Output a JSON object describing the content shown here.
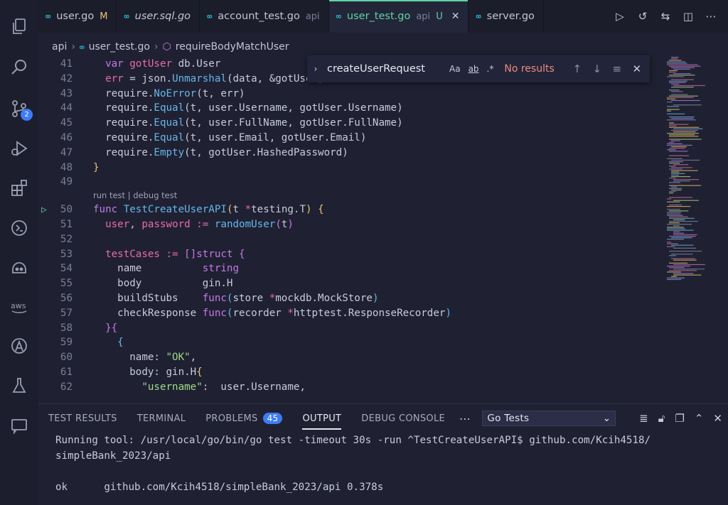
{
  "tabs": [
    {
      "name": "user.go",
      "icon": "go",
      "status": "M",
      "dir": "",
      "active": false,
      "italic": false
    },
    {
      "name": "user.sql.go",
      "icon": "go",
      "status": "",
      "dir": "",
      "active": false,
      "italic": true
    },
    {
      "name": "account_test.go",
      "icon": "go",
      "status": "",
      "dir": "api",
      "active": false,
      "italic": false
    },
    {
      "name": "user_test.go",
      "icon": "go",
      "status": "U",
      "dir": "api",
      "active": true,
      "italic": false
    },
    {
      "name": "server.go",
      "icon": "go",
      "status": "",
      "dir": "",
      "active": false,
      "italic": false
    }
  ],
  "tab_icon_glyph": "∞",
  "close_glyph": "✕",
  "breadcrumb": {
    "folder": "api",
    "file": "user_test.go",
    "symbol": "requireBodyMatchUser"
  },
  "find": {
    "query": "createUserRequest",
    "match_case": "Aa",
    "whole_word": "ab",
    "regex": ".*",
    "result": "No results"
  },
  "codelens": "run test | debug test",
  "code_lines": [
    {
      "n": "41",
      "html": "  <span class='kw'>var</span> <span class='id'>gotUser</span> db.User"
    },
    {
      "n": "42",
      "html": "  <span class='id'>err</span> = json.<span class='fn'>Unmarshal</span>(data, &amp;gotUser)"
    },
    {
      "n": "43",
      "html": "  require.<span class='fn'>NoError</span>(t, err)"
    },
    {
      "n": "44",
      "html": "  require.<span class='fn'>Equal</span>(t, user.Username, gotUser.Username)"
    },
    {
      "n": "45",
      "html": "  require.<span class='fn'>Equal</span>(t, user.FullName, gotUser.FullName)"
    },
    {
      "n": "46",
      "html": "  require.<span class='fn'>Equal</span>(t, user.Email, gotUser.Email)"
    },
    {
      "n": "47",
      "html": "  require.<span class='fn'>Empty</span>(t, gotUser.HashedPassword)"
    },
    {
      "n": "48",
      "html": "<span class='br1'>}</span>"
    },
    {
      "n": "49",
      "html": ""
    },
    {
      "n": "50",
      "html": "<span class='kw'>func</span> <span class='fn'>TestCreateUserAPI</span><span class='br1'>(</span>t <span class='id'>*</span>testing.T<span class='br1'>)</span> <span class='br1'>{</span>"
    },
    {
      "n": "51",
      "html": "  <span class='id'>user</span>, <span class='id'>password</span> <span class='id'>:=</span> <span class='fn'>randomUser</span><span class='br2'>(</span>t<span class='br2'>)</span>"
    },
    {
      "n": "52",
      "html": ""
    },
    {
      "n": "53",
      "html": "  <span class='id'>testCases</span> <span class='id'>:=</span> <span class='br2'>[]</span><span class='kw'>struct</span> <span class='br2'>{</span>"
    },
    {
      "n": "54",
      "html": "    name          <span class='kw'>string</span>"
    },
    {
      "n": "55",
      "html": "    body          gin.H"
    },
    {
      "n": "56",
      "html": "    buildStubs    <span class='kw'>func</span><span class='br3'>(</span>store <span class='id'>*</span>mockdb.MockStore<span class='br3'>)</span>"
    },
    {
      "n": "57",
      "html": "    checkResponse <span class='kw'>func</span><span class='br3'>(</span>recorder <span class='id'>*</span>httptest.ResponseRecorder<span class='br3'>)</span>"
    },
    {
      "n": "58",
      "html": "  <span class='br2'>}{</span>"
    },
    {
      "n": "59",
      "html": "    <span class='br3'>{</span>"
    },
    {
      "n": "60",
      "html": "      name: <span class='str'>\"OK\"</span>,"
    },
    {
      "n": "61",
      "html": "      body: gin.H<span class='br1'>{</span>"
    },
    {
      "n": "62",
      "html": "        <span class='str'>\"username\"</span>:  user.Username,"
    }
  ],
  "panel": {
    "tabs": [
      "TEST RESULTS",
      "TERMINAL",
      "PROBLEMS",
      "OUTPUT",
      "DEBUG CONSOLE"
    ],
    "problems_count": "45",
    "active_tab": "OUTPUT",
    "select_value": "Go Tests",
    "output_lines": [
      "Running tool: /usr/local/go/bin/go test -timeout 30s -run ^TestCreateUserAPI$ github.com/Kcih4518/",
      "simpleBank_2023/api",
      "",
      "ok  \tgithub.com/Kcih4518/simpleBank_2023/api\t0.378s"
    ]
  },
  "activity_badge": "2",
  "colors": {
    "accent": "#5fd3a5",
    "badge": "#3d7cf5",
    "editor_bg": "#1f2132"
  }
}
